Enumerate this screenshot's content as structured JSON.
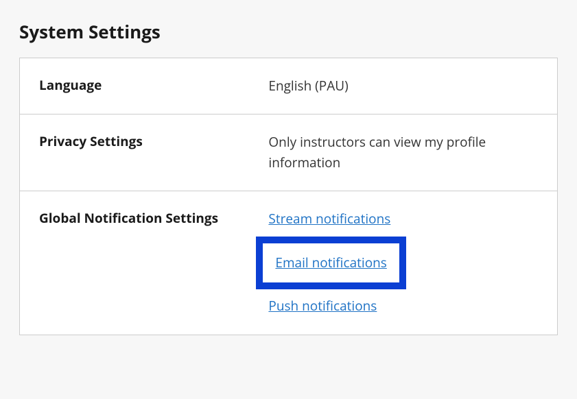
{
  "page": {
    "title": "System Settings"
  },
  "rows": {
    "language": {
      "label": "Language",
      "value": "English (PAU)"
    },
    "privacy": {
      "label": "Privacy Settings",
      "value": "Only instructors can view my profile information"
    },
    "notifications": {
      "label": "Global Notification Settings",
      "links": {
        "stream": "Stream notifications",
        "email": "Email notifications",
        "push": "Push notifications"
      }
    }
  }
}
